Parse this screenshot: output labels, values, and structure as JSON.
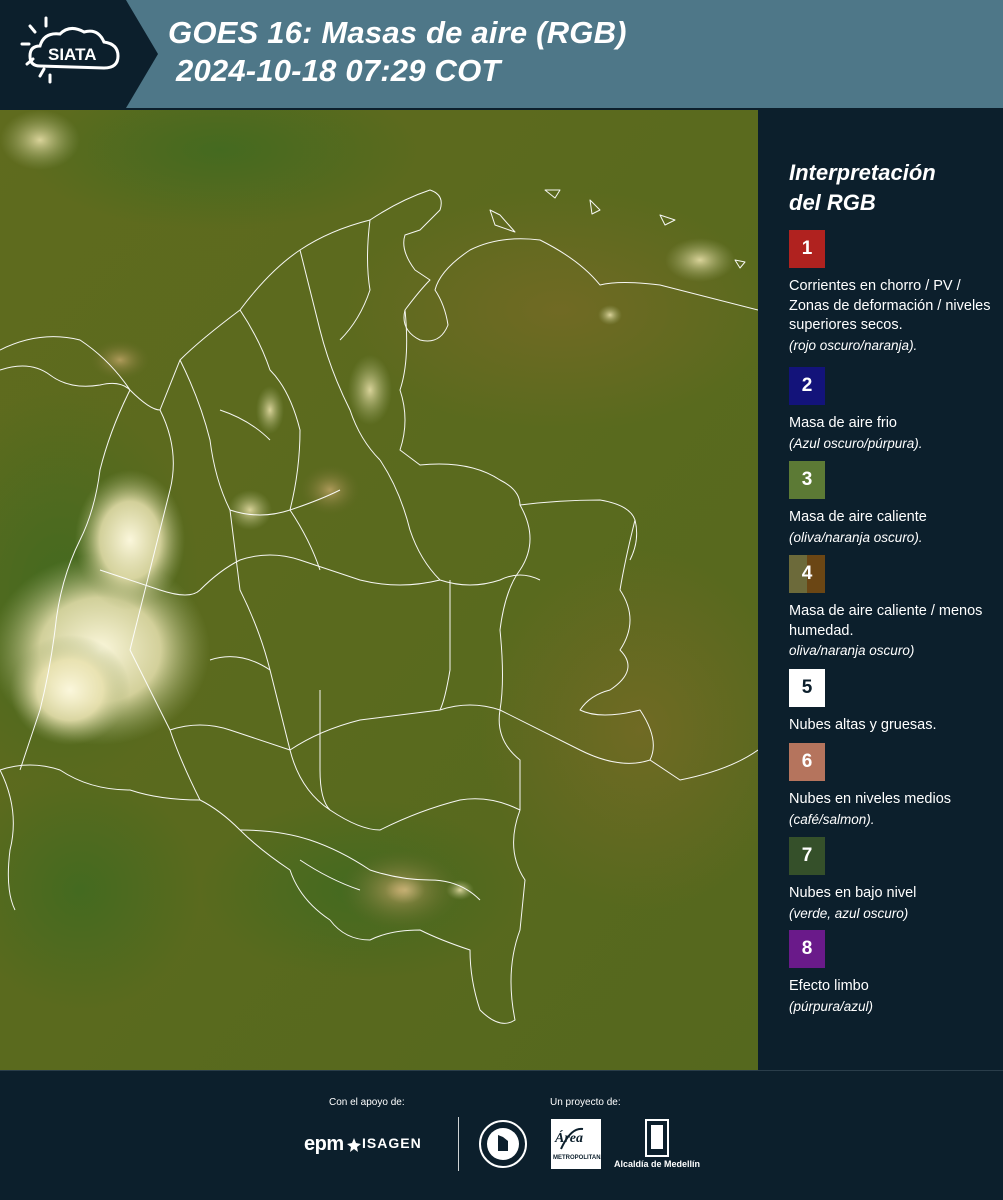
{
  "header": {
    "logo_text": "SIATA",
    "title_line1": "GOES 16: Masas de aire (RGB)",
    "title_line2": "2024-10-18 07:29 COT"
  },
  "legend": {
    "title_line1": "Interpretación",
    "title_line2": "del RGB",
    "items": [
      {
        "number": "1",
        "color": "#b0221f",
        "text": "Corrientes en chorro / PV / Zonas de deformación / niveles superiores secos.",
        "sub": "(rojo oscuro/naranja)."
      },
      {
        "number": "2",
        "color": "#13137a",
        "text": "Masa de aire frio",
        "sub": "(Azul oscuro/púrpura)."
      },
      {
        "number": "3",
        "color": "#5c7a35",
        "text": "Masa de aire caliente",
        "sub": "(oliva/naranja oscuro)."
      },
      {
        "number": "4",
        "color_left": "#6c6a3a",
        "color_right": "#6b4614",
        "text": "Masa de aire caliente / menos humedad.",
        "sub": "oliva/naranja oscuro)"
      },
      {
        "number": "5",
        "color": "#ffffff",
        "text": "Nubes altas y gruesas.",
        "sub": ""
      },
      {
        "number": "6",
        "color": "#b5745d",
        "text": "Nubes en niveles medios",
        "sub": "(café/salmon)."
      },
      {
        "number": "7",
        "color": "#35502a",
        "text": "Nubes en bajo nivel",
        "sub": "(verde, azul oscuro)"
      },
      {
        "number": "8",
        "color": "#6a1a8a",
        "text": "Efecto limbo",
        "sub": "(púrpura/azul)"
      }
    ]
  },
  "footer": {
    "support_label": "Con el apoyo de:",
    "project_label": "Un proyecto de:",
    "sponsor1": "epm",
    "sponsor2": "ISAGEN",
    "amva_label": "Área",
    "amva_sub": "METROPOLITANA",
    "medellin_label": "Alcaldía de Medellín"
  },
  "map": {
    "image_description_colors": {
      "base": "#5a6a1c",
      "clouds": "#f4f0d0"
    }
  }
}
